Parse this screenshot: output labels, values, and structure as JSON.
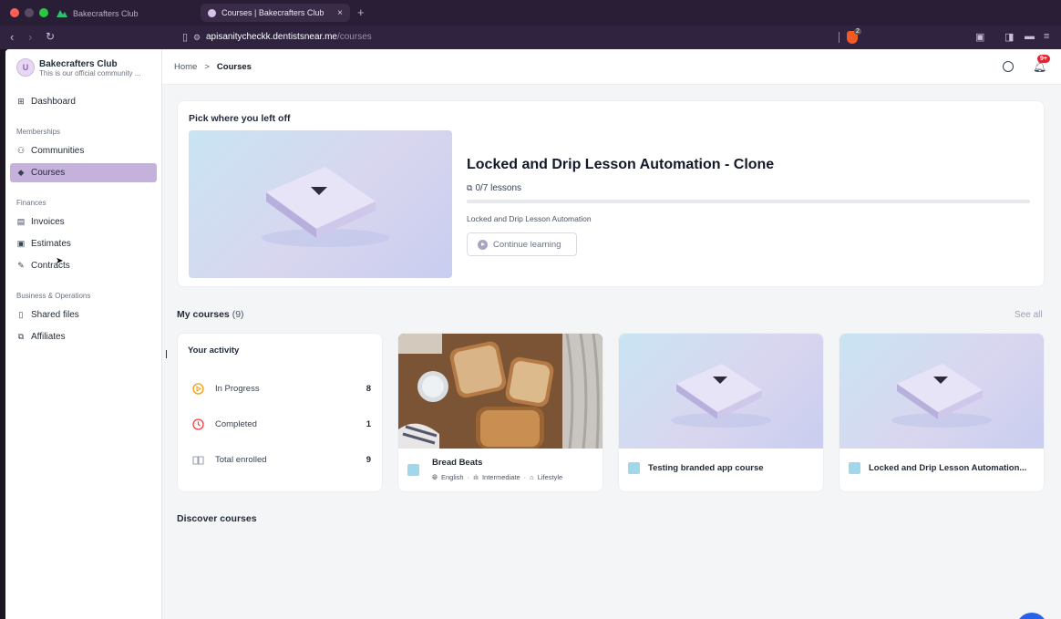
{
  "browser": {
    "tab_inactive": "Bakecrafters Club",
    "tab_active": "Courses | Bakecrafters Club",
    "tab_close": "×",
    "tab_new": "+",
    "url_host": "apisanitycheckk.dentistsnear.me",
    "url_path": "/courses",
    "shield_count": "2"
  },
  "org": {
    "avatar_letter": "U",
    "name": "Bakecrafters Club",
    "description": "This is our official community ..."
  },
  "sidebar": {
    "dashboard": "Dashboard",
    "section_memberships": "Memberships",
    "communities": "Communities",
    "courses": "Courses",
    "section_finances": "Finances",
    "invoices": "Invoices",
    "estimates": "Estimates",
    "contracts": "Contracts",
    "section_business": "Business & Operations",
    "shared_files": "Shared files",
    "affiliates": "Affiliates"
  },
  "header": {
    "crumb_home": "Home",
    "crumb_sep": ">",
    "crumb_current": "Courses",
    "notif_badge": "9+"
  },
  "continue": {
    "heading": "Pick where you left off",
    "course_title": "Locked and Drip Lesson Automation - Clone",
    "lessons": "0/7 lessons",
    "progress": 0,
    "subtitle": "Locked and Drip Lesson Automation",
    "button": "Continue learning"
  },
  "my_courses": {
    "heading": "My courses",
    "count": "(9)",
    "see_all": "See all"
  },
  "activity": {
    "title": "Your activity",
    "rows": [
      {
        "label": "In Progress",
        "value": "8",
        "icon": "play-circle-icon",
        "color": "#f59e0b"
      },
      {
        "label": "Completed",
        "value": "1",
        "icon": "clock-icon",
        "color": "#ef4444"
      },
      {
        "label": "Total enrolled",
        "value": "9",
        "icon": "book-open-icon",
        "color": "#9ca3af"
      }
    ]
  },
  "courses": [
    {
      "name": "Bread Beats",
      "language": "English",
      "level": "Intermediate",
      "category": "Lifestyle"
    },
    {
      "name": "Testing branded app course"
    },
    {
      "name": "Locked and Drip Lesson Automation..."
    }
  ],
  "discover": {
    "heading": "Discover courses"
  }
}
